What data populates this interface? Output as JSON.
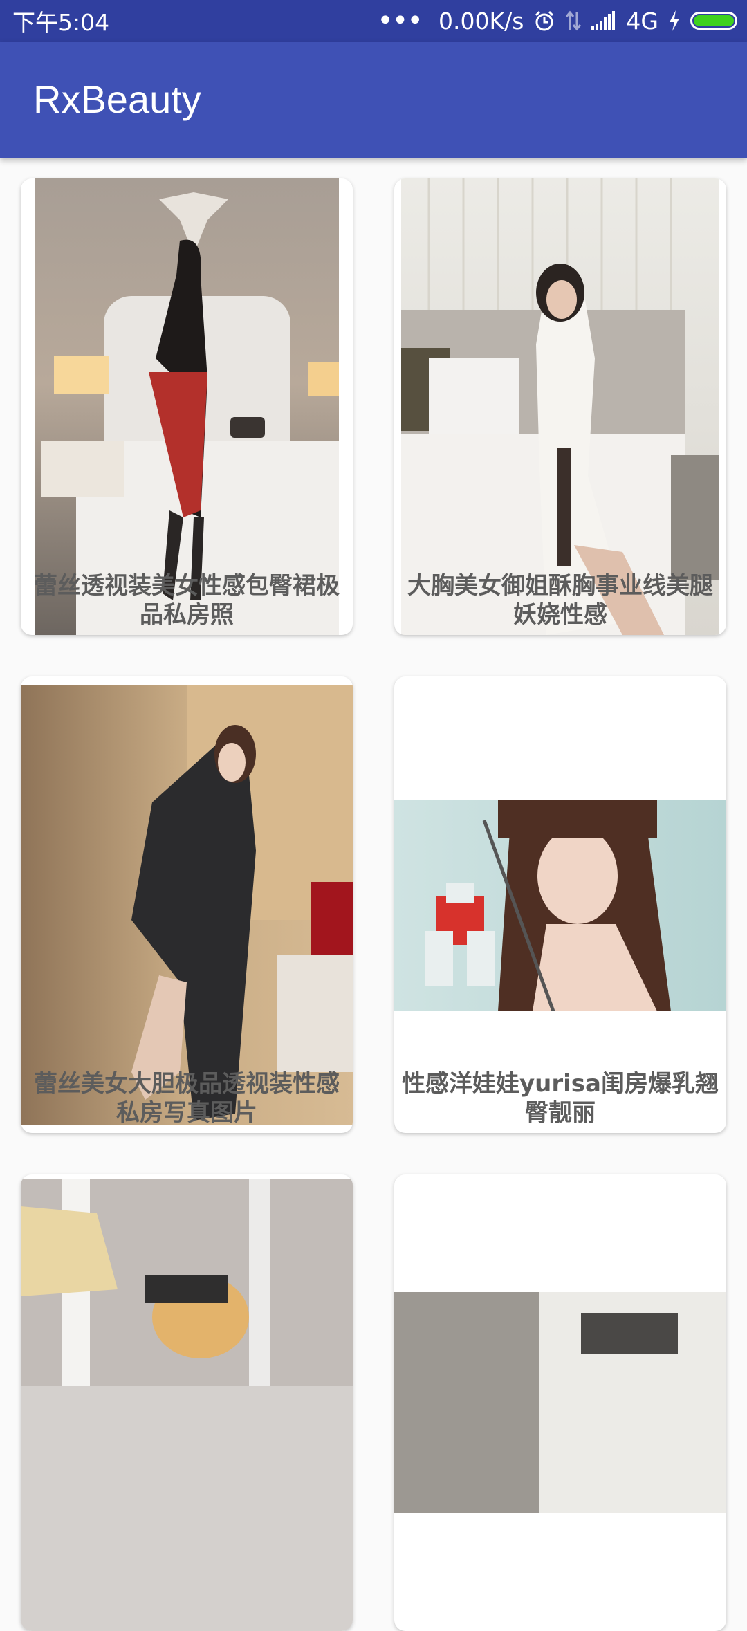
{
  "status_bar": {
    "time": "下午5:04",
    "dots": "•••",
    "network_speed": "0.00K/s",
    "network_type": "4G",
    "battery_color": "#3fd11e",
    "icons": [
      "alarm-icon",
      "data-transfer-icon",
      "signal-icon",
      "charging-icon",
      "battery-icon"
    ]
  },
  "app_bar": {
    "title": "RxBeauty",
    "color": "#3f51b5"
  },
  "gallery": {
    "items": [
      {
        "caption": "蕾丝透视装美女性感包臀裙极品私房照"
      },
      {
        "caption": "大胸美女御姐酥胸事业线美腿妖娆性感"
      },
      {
        "caption": "蕾丝美女大胆极品透视装性感私房写真图片"
      },
      {
        "caption": "性感洋娃娃yurisa闺房爆乳翘臀靓丽"
      },
      {
        "caption": ""
      },
      {
        "caption": ""
      }
    ]
  }
}
